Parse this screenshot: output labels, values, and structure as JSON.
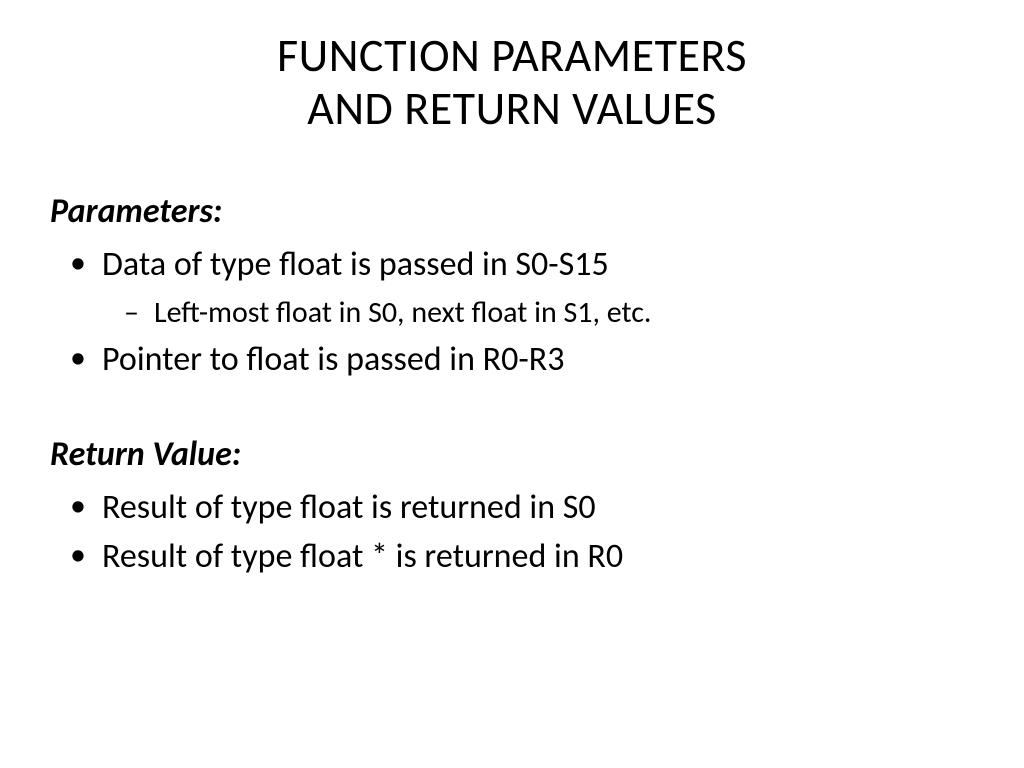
{
  "title_line1": "FUNCTION PARAMETERS",
  "title_line2": "AND RETURN VALUES",
  "sections": {
    "parameters": {
      "heading": "Parameters:",
      "items": [
        {
          "text": "Data of type float is passed in S0-S15",
          "subitems": [
            "Left-most float in S0, next float in S1, etc."
          ]
        },
        {
          "text": "Pointer to float is passed in R0-R3",
          "subitems": []
        }
      ]
    },
    "return_value": {
      "heading": "Return Value:",
      "items": [
        {
          "text": "Result of type float is returned in S0",
          "subitems": []
        },
        {
          "text": "Result of type float * is returned in R0",
          "subitems": []
        }
      ]
    }
  }
}
